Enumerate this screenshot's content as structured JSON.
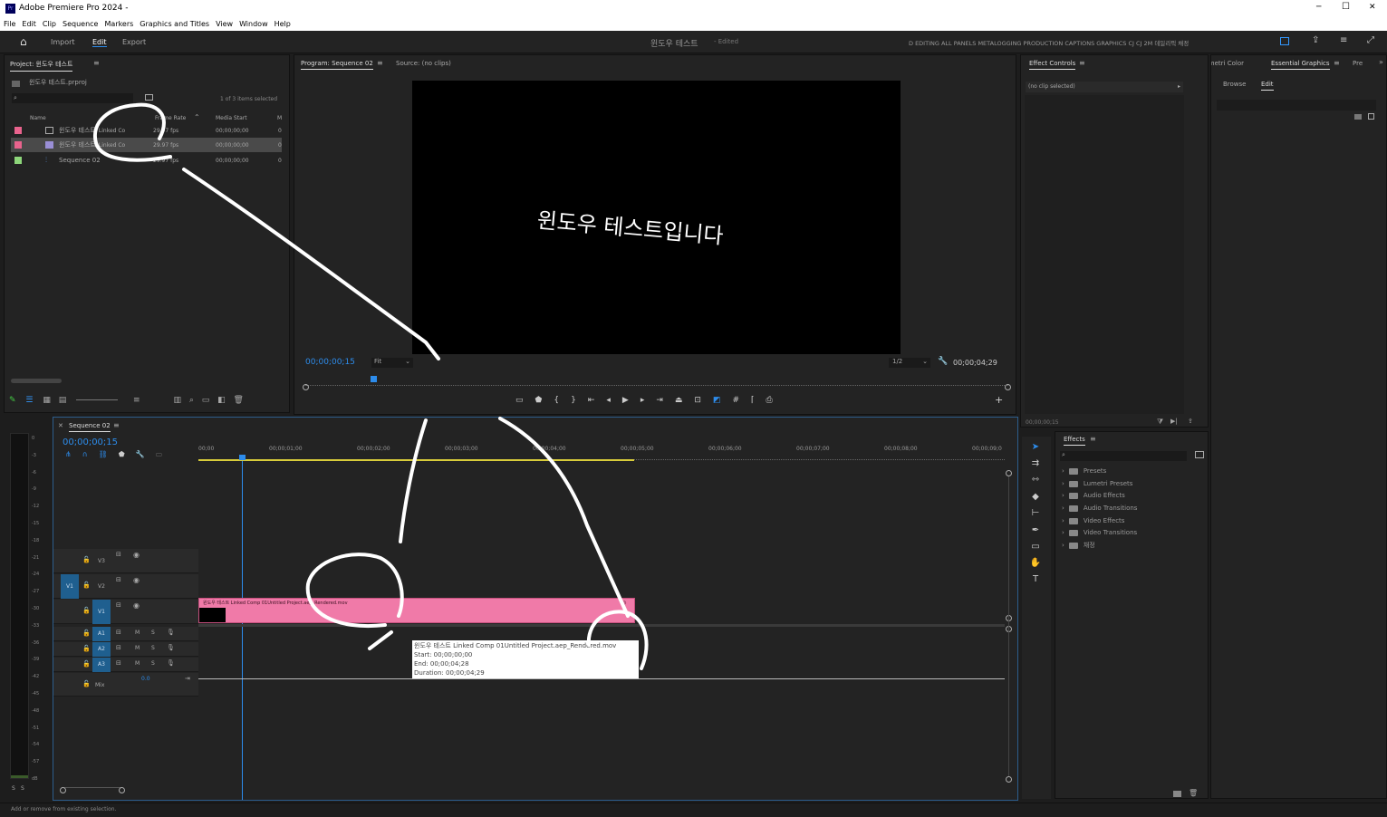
{
  "titlebar": {
    "title": "Adobe Premiere Pro 2024 -",
    "minimize": "─",
    "maximize": "☐",
    "close": "✕"
  },
  "menu": [
    "File",
    "Edit",
    "Clip",
    "Sequence",
    "Markers",
    "Graphics and Titles",
    "View",
    "Window",
    "Help"
  ],
  "header": {
    "tabs": [
      "Import",
      "Edit",
      "Export"
    ],
    "project_name": "윈도우 테스트",
    "edited": "- Edited",
    "workspaces": "D EDITING  ALL PANELS  METALOGGING  PRODUCTION  CAPTIONS  GRAPHICS  CJ  CJ 2M  데일리픽 채정"
  },
  "project": {
    "title": "Project: 윈도우 테스트",
    "file": "윈도우 테스트.prproj",
    "selection": "1 of 3 items selected",
    "cols": {
      "name": "Name",
      "frame_rate": "Frame Rate",
      "media_start": "Media Start",
      "m": "M"
    },
    "rows": [
      {
        "name": "윈도우 테스트",
        "extra": "Linked Co",
        "rate": "29.97 fps",
        "start": "00;00;00;00",
        "m": "0",
        "color": "#e9638d"
      },
      {
        "name": "윈도우 테스트",
        "extra": "Linked Co",
        "rate": "29.97 fps",
        "start": "00;00;00;00",
        "m": "0",
        "color": "#e9638d"
      },
      {
        "name": "Sequence 02",
        "extra": "",
        "rate": "29.97 fps",
        "start": "00;00;00;00",
        "m": "0",
        "color": "#8dd67a"
      }
    ]
  },
  "program": {
    "tab": "Program: Sequence 02",
    "source_tab": "Source: (no clips)",
    "video_text": "윈도우 테스트입니다",
    "timecode": "00;00;00;15",
    "fit": "Fit",
    "quality": "1/2",
    "duration": "00;00;04;29"
  },
  "effect_controls": {
    "tab": "Effect Controls",
    "no_clip": "(no clip selected)",
    "timecode": "00;00;00;15"
  },
  "essential": {
    "lumetri": "Lumetri Color",
    "tab": "Essential Graphics",
    "pre": "Pre",
    "browse": "Browse",
    "edit": "Edit"
  },
  "timeline": {
    "tab": "Sequence 02",
    "timecode": "00;00;00;15",
    "ruler": [
      "00;00",
      "00;00;01;00",
      "00;00;02;00",
      "00;00;03;00",
      "00;00;04;00",
      "00;00;05;00",
      "00;00;06;00",
      "00;00;07;00",
      "00;00;08;00",
      "00;00;09;0"
    ],
    "tracks": {
      "v3": "V3",
      "v2": "V2",
      "v1": "V1",
      "a1": "A1",
      "a2": "A2",
      "a3": "A3",
      "mix": "Mix",
      "mix_val": "0.0",
      "src_v1": "V1"
    },
    "clip": "윈도우 테스트 Linked Comp 01Untitled Project.aep_Rendered.mov",
    "tooltip": {
      "name": "윈도우 테스트 Linked Comp 01Untitled Project.aep_Rendered.mov",
      "start": "Start: 00;00;00;00",
      "end": "End: 00;00;04;28",
      "duration": "Duration: 00;00;04;29"
    }
  },
  "meter": {
    "labels": [
      "0",
      "-3",
      "-6",
      "-9",
      "-12",
      "-15",
      "-18",
      "-21",
      "-24",
      "-27",
      "-30",
      "-33",
      "-36",
      "-39",
      "-42",
      "-45",
      "-48",
      "-51",
      "-54",
      "-57",
      "dB"
    ],
    "solo": "S"
  },
  "effects": {
    "tab": "Effects",
    "items": [
      "Presets",
      "Lumetri Presets",
      "Audio Effects",
      "Audio Transitions",
      "Video Effects",
      "Video Transitions",
      "채정"
    ]
  },
  "status": "Add or remove from existing selection."
}
